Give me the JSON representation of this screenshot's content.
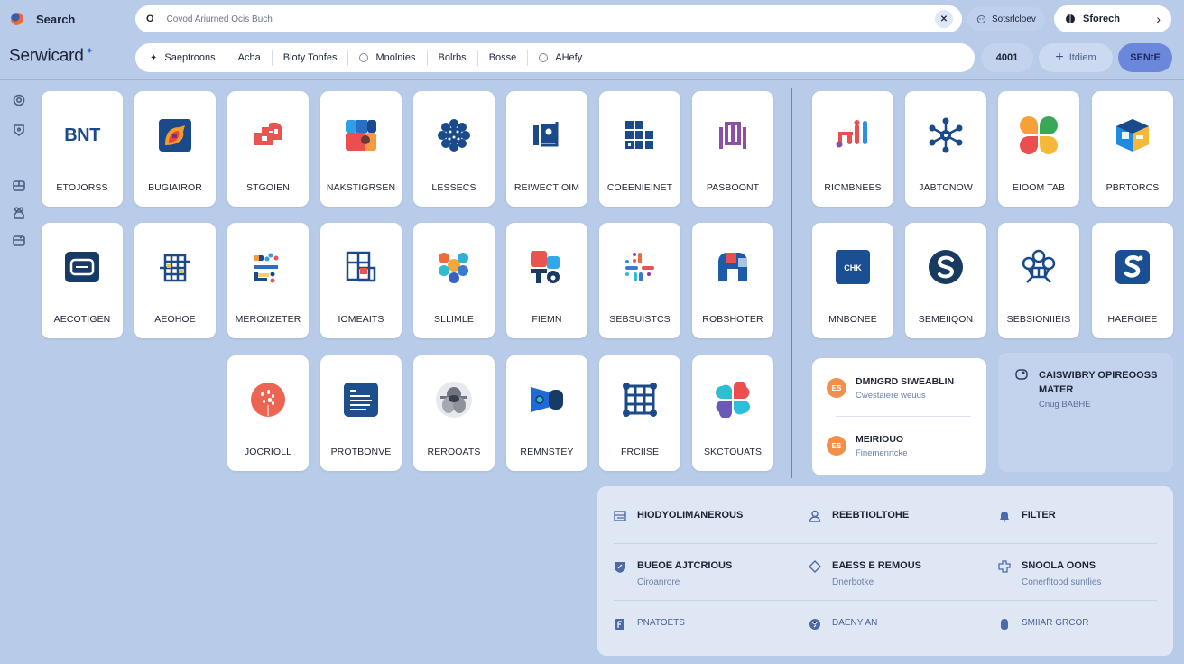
{
  "header": {
    "brand_search": "Search",
    "app_title": "Serwicard",
    "search": {
      "placeholder": "Covod Ariurned Ocis Buch",
      "value": ""
    },
    "saved_chip": "Sotsrlcloev",
    "search_pill": "Sforech"
  },
  "filters": {
    "items": [
      {
        "label": "Saeptroons",
        "icon": "pin-icon"
      },
      {
        "label": "Acha",
        "icon": ""
      },
      {
        "label": "Bloty Tonfes",
        "icon": ""
      },
      {
        "label": "Mnolnies",
        "icon": "radio"
      },
      {
        "label": "Bolrbs",
        "icon": ""
      },
      {
        "label": "Bosse",
        "icon": ""
      },
      {
        "label": "AHefy",
        "icon": "radio"
      }
    ],
    "count": "4001",
    "add_label": "Itdiem",
    "save_label": "SENtE"
  },
  "sidebar": {
    "icons": [
      "settings-icon",
      "shield-icon",
      "layout-icon",
      "users-icon",
      "card-icon"
    ]
  },
  "tiles": [
    {
      "label": "ETOJORSS",
      "icon": "text-logo-icon",
      "icon_text": "BNT"
    },
    {
      "label": "BUGIAIROR",
      "icon": "orange-flame-icon"
    },
    {
      "label": "STGOIEN",
      "icon": "red-puzzle-icon"
    },
    {
      "label": "NAKSTIGRSEN",
      "icon": "color-blocks-icon"
    },
    {
      "label": "LESSECS",
      "icon": "snowflake-icon"
    },
    {
      "label": "REIWECTIOIM",
      "icon": "photo-frame-icon"
    },
    {
      "label": "COEENIEINET",
      "icon": "grid-icon"
    },
    {
      "label": "PASBOONT",
      "icon": "purple-pillars-icon"
    },
    {
      "label": "AECOTIGEN",
      "icon": "dark-chat-icon"
    },
    {
      "label": "AEOHOE",
      "icon": "grid-network-icon"
    },
    {
      "label": "MEROIIZETER",
      "icon": "list-dots-icon"
    },
    {
      "label": "IOMEAITS",
      "icon": "window-grid-icon"
    },
    {
      "label": "SLLIMLE",
      "icon": "color-circles-icon"
    },
    {
      "label": "FIEMN",
      "icon": "blocks-icon"
    },
    {
      "label": "SEBSUISTCS",
      "icon": "slack-like-icon"
    },
    {
      "label": "ROBSHOTER",
      "icon": "arch-icon"
    },
    {
      "label": "JOCRIOLL",
      "icon": "red-dots-icon"
    },
    {
      "label": "PROTBONVE",
      "icon": "document-icon"
    },
    {
      "label": "REROOATS",
      "icon": "gray-mascot-icon"
    },
    {
      "label": "REMNSTEY",
      "icon": "video-camera-icon"
    },
    {
      "label": "FRCIISE",
      "icon": "frame-grid-icon"
    },
    {
      "label": "SKCTOUATS",
      "icon": "petals-icon"
    }
  ],
  "right_tiles": [
    {
      "label": "RICMBNEES",
      "icon": "bar-chart-icon"
    },
    {
      "label": "JABTCNOW",
      "icon": "network-hub-icon"
    },
    {
      "label": "EIOOM TAB",
      "icon": "clover-icon"
    },
    {
      "label": "PBRTORCS",
      "icon": "cube-icon"
    },
    {
      "label": "MNBONEE",
      "icon": "text-box-icon",
      "icon_text": "CHK"
    },
    {
      "label": "SEMEIIQON",
      "icon": "s-circle-icon"
    },
    {
      "label": "SEBSIONIIEIS",
      "icon": "people-network-icon"
    },
    {
      "label": "HAERGIEE",
      "icon": "s-square-icon"
    }
  ],
  "people_card": {
    "people": [
      {
        "initials": "ES",
        "name": "DMNGRD SIWEABLIN",
        "subtitle": "Cwestaiere weuus"
      },
      {
        "initials": "ES",
        "name": "MEIRIOUO",
        "subtitle": "Finemenrtcke"
      }
    ]
  },
  "note_card": {
    "title": "CAISWIBRY OPIREOOSS MATER",
    "subtitle": "Cnug BABHE"
  },
  "panel": {
    "rows": [
      [
        {
          "title": "HIODYOLIMANEROUS",
          "subtitle": "",
          "icon": "list-icon"
        },
        {
          "title": "REEBTIOLTOHE",
          "subtitle": "",
          "icon": "user-icon"
        },
        {
          "title": "FILTER",
          "subtitle": "",
          "icon": "bell-icon"
        }
      ],
      [
        {
          "title": "BUEOE AJTCRIOUS",
          "subtitle": "Ciroanrore",
          "icon": "shield-leaf-icon"
        },
        {
          "title": "EAESS E REMOUS",
          "subtitle": "Dnerbotke",
          "icon": "diamond-icon"
        },
        {
          "title": "SNOOLA OONS",
          "subtitle": "Conerfltood suntlies",
          "icon": "puzzle-icon"
        }
      ],
      [
        {
          "title": "PNATOETS",
          "subtitle": "",
          "icon": "bookmark-icon"
        },
        {
          "title": "DAENY AN",
          "subtitle": "",
          "icon": "globe-icon"
        },
        {
          "title": "SMIIAR GRCOR",
          "subtitle": "",
          "icon": "hand-icon"
        }
      ]
    ]
  },
  "colors": {
    "background": "#b8cbe8",
    "accent": "#6b87dc",
    "navy": "#1b4a8a",
    "orange": "#f0904d"
  }
}
